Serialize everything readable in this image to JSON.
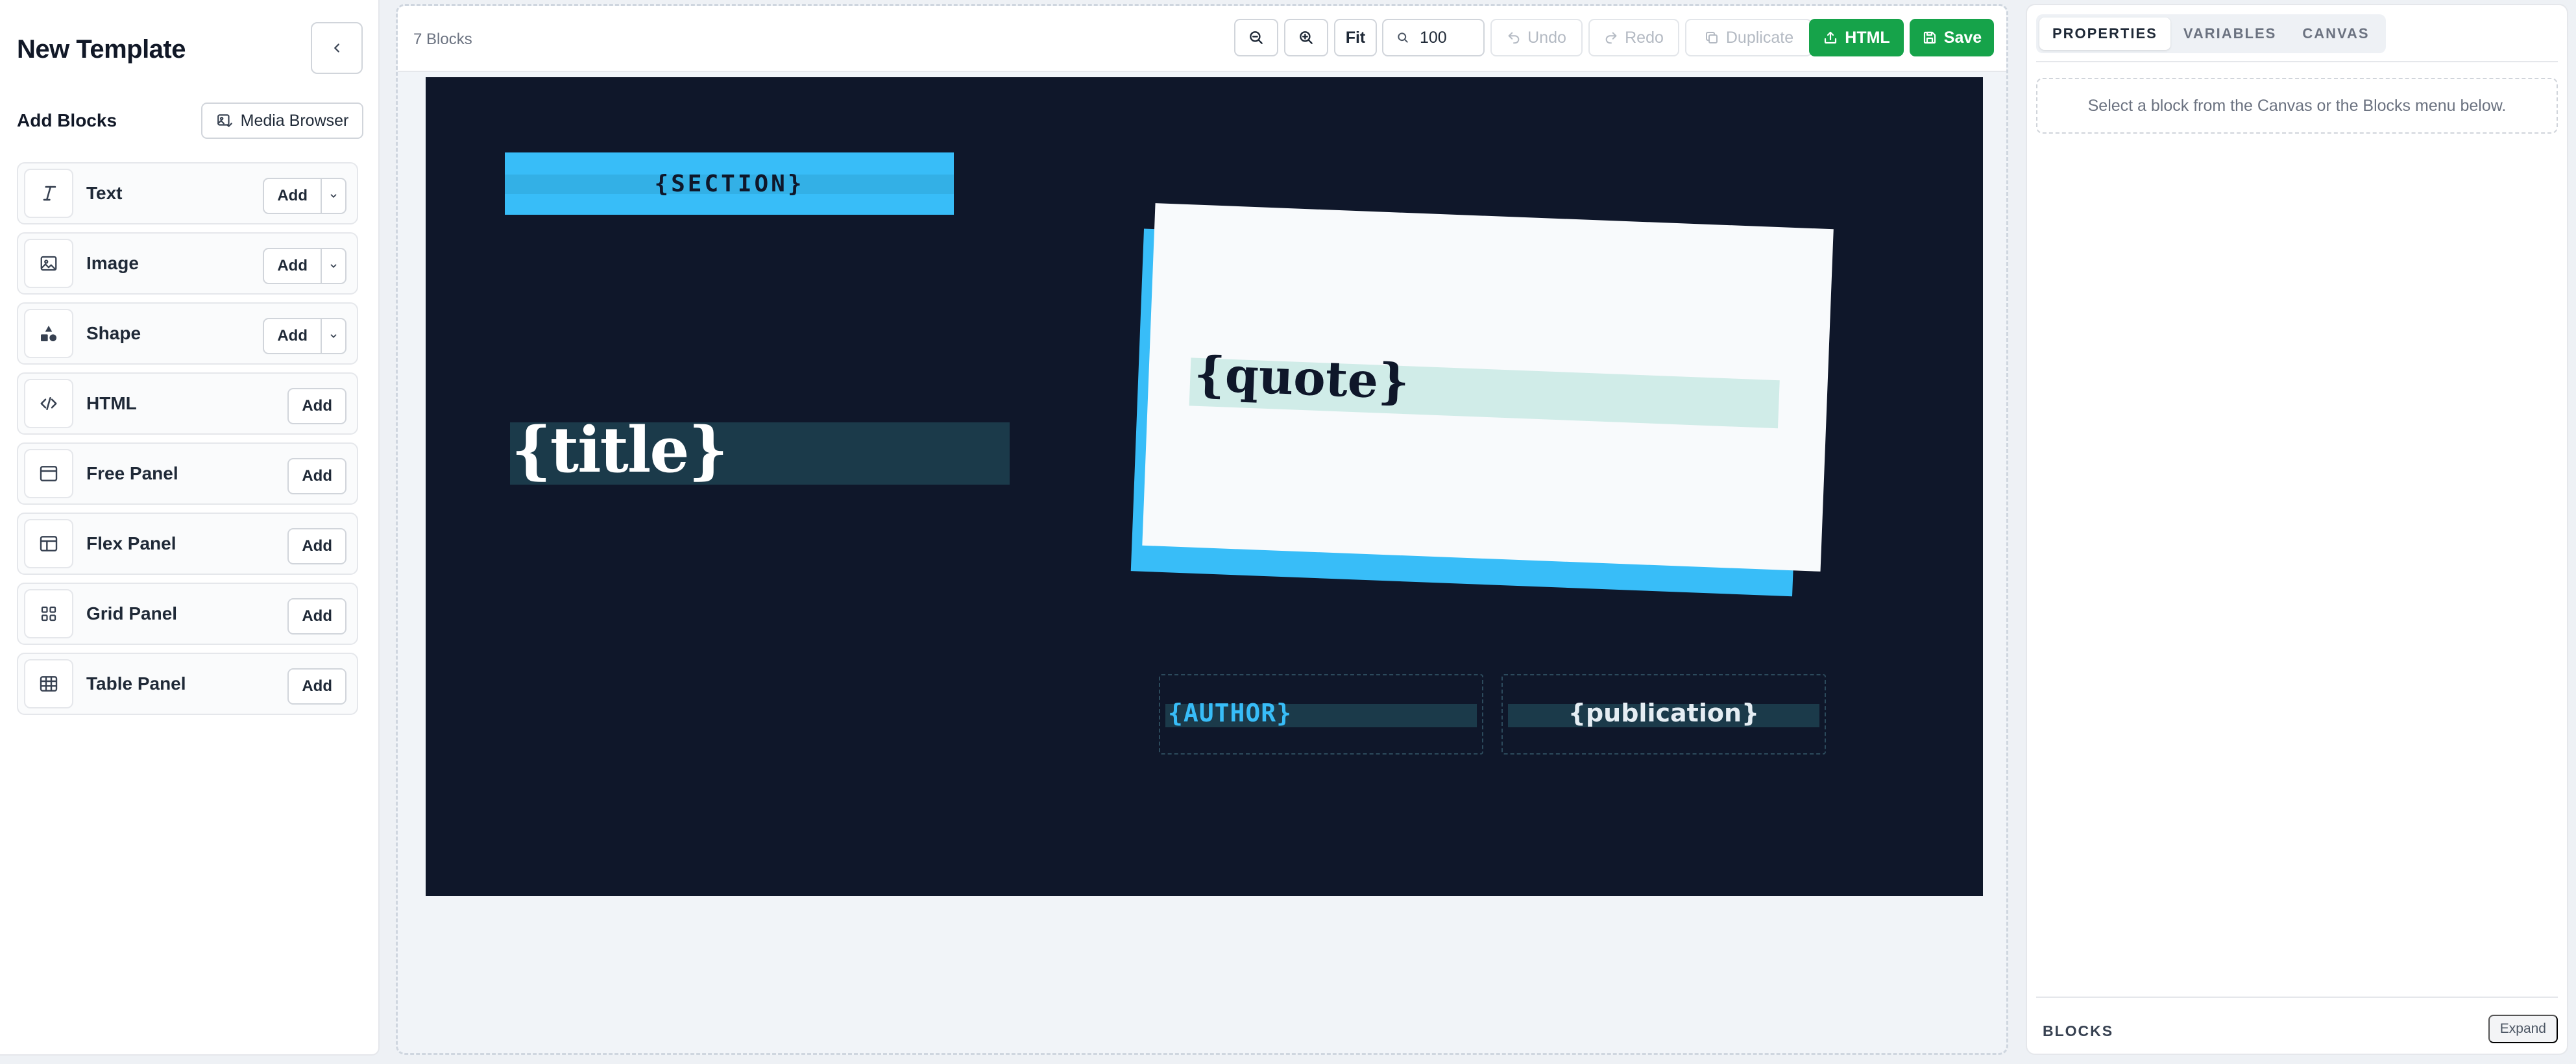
{
  "sidebar": {
    "title": "New Template",
    "add_blocks_label": "Add Blocks",
    "media_browser_label": "Media Browser",
    "items": [
      {
        "label": "Text",
        "add_label": "Add",
        "icon": "text-icon",
        "has_menu": true
      },
      {
        "label": "Image",
        "add_label": "Add",
        "icon": "image-icon",
        "has_menu": true
      },
      {
        "label": "Shape",
        "add_label": "Add",
        "icon": "shape-icon",
        "has_menu": true
      },
      {
        "label": "HTML",
        "add_label": "Add",
        "icon": "code-icon",
        "has_menu": false
      },
      {
        "label": "Free Panel",
        "add_label": "Add",
        "icon": "window-icon",
        "has_menu": false
      },
      {
        "label": "Flex Panel",
        "add_label": "Add",
        "icon": "layout-icon",
        "has_menu": false
      },
      {
        "label": "Grid Panel",
        "add_label": "Add",
        "icon": "grid-icon",
        "has_menu": false
      },
      {
        "label": "Table Panel",
        "add_label": "Add",
        "icon": "table-icon",
        "has_menu": false
      }
    ]
  },
  "toolbar": {
    "block_count": "7 Blocks",
    "fit_label": "Fit",
    "zoom_value": "100",
    "undo_label": "Undo",
    "redo_label": "Redo",
    "duplicate_label": "Duplicate",
    "html_label": "HTML",
    "save_label": "Save"
  },
  "canvas": {
    "background": "#0f172a",
    "accent": "#38bdf8",
    "section_text": "{SECTION}",
    "title_text": "{title}",
    "quote_text": "{quote}",
    "author_text": "{AUTHOR}",
    "publication_text": "{publication}"
  },
  "panel": {
    "tabs": [
      "PROPERTIES",
      "VARIABLES",
      "CANVAS"
    ],
    "active_tab": "PROPERTIES",
    "hint": "Select a block from the Canvas or the Blocks menu below.",
    "blocks_label": "BLOCKS",
    "expand_label": "Expand"
  },
  "colors": {
    "primary_green": "#16a34a",
    "accent_blue": "#38bdf8"
  }
}
